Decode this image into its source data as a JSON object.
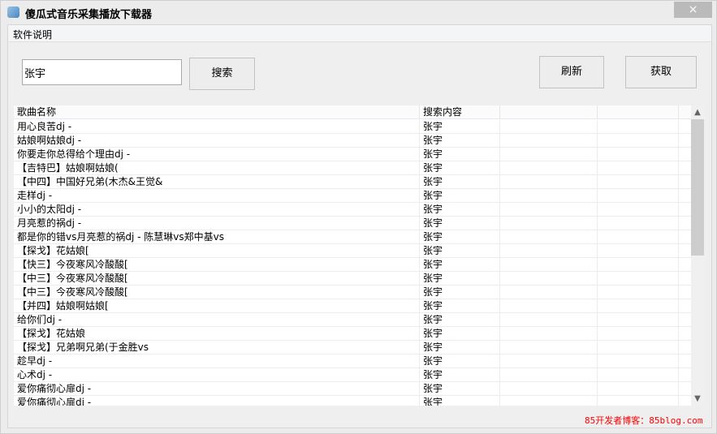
{
  "window": {
    "title": "傻瓜式音乐采集播放下载器",
    "close_icon": "×"
  },
  "menu": {
    "items": [
      {
        "label": "软件说明"
      }
    ]
  },
  "search": {
    "value": "张宇",
    "button": "搜索"
  },
  "toolbar": {
    "refresh": "刷新",
    "fetch": "获取"
  },
  "list": {
    "columns": [
      "歌曲名称",
      "搜索内容",
      "",
      ""
    ],
    "rows": [
      [
        "用心良苦dj -",
        "张宇"
      ],
      [
        "姑娘啊姑娘dj -",
        "张宇"
      ],
      [
        "你要走你总得给个理由dj -",
        "张宇"
      ],
      [
        "【吉特巴】姑娘啊姑娘(",
        "张宇"
      ],
      [
        "【中四】中国好兄弟(木杰&王觉&",
        "张宇"
      ],
      [
        "走样dj -",
        "张宇"
      ],
      [
        "小小的太阳dj -",
        "张宇"
      ],
      [
        "月亮惹的祸dj -",
        "张宇"
      ],
      [
        "都是你的错vs月亮惹的祸dj - 陈慧琳vs郑中基vs",
        "张宇"
      ],
      [
        "【探戈】花姑娘[",
        "张宇"
      ],
      [
        "【快三】今夜寒风冷酸酸[",
        "张宇"
      ],
      [
        "【中三】今夜寒风冷酸酸[",
        "张宇"
      ],
      [
        "【中三】今夜寒风冷酸酸[",
        "张宇"
      ],
      [
        "【并四】姑娘啊姑娘[",
        "张宇"
      ],
      [
        "给你们dj -",
        "张宇"
      ],
      [
        "【探戈】花姑娘",
        "张宇"
      ],
      [
        "【探戈】兄弟啊兄弟(于金胜vs",
        "张宇"
      ],
      [
        "趁早dj -",
        "张宇"
      ],
      [
        "心术dj -",
        "张宇"
      ],
      [
        "爱你痛彻心扉dj -",
        "张宇"
      ],
      [
        "爱你痛彻心扉dj -",
        "张宇"
      ]
    ],
    "scroll": {
      "position_fraction": 0.0,
      "visible_fraction": 0.5
    }
  },
  "footer": {
    "text": "85开发者博客：85blog.com",
    "color": "#ff0000"
  }
}
